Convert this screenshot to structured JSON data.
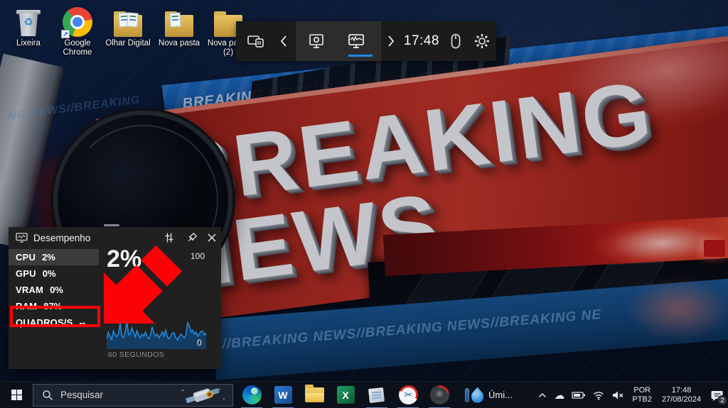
{
  "desktop": {
    "icons": [
      {
        "label": "Lixeira"
      },
      {
        "label": "Google Chrome"
      },
      {
        "label": "Olhar Digital"
      },
      {
        "label": "Nova pasta"
      },
      {
        "label": "Nova pasta (2)"
      }
    ]
  },
  "wallpaper": {
    "headline_line1": "BREAKING",
    "headline_line2": "NEWS",
    "ticker_top": "BREAKING NEWS//BREAKING NEWS//BREAKING NEWS",
    "ticker_left_faint": "NG NEWS//BREAKING",
    "ticker_bottom": "//BREAKING NEWS//BREAKING NEWS//BREAKING NE"
  },
  "gamebar": {
    "time": "17:48"
  },
  "performance_widget": {
    "title": "Desempenho",
    "rows": [
      {
        "label": "CPU",
        "value": "2%",
        "selected": true
      },
      {
        "label": "GPU",
        "value": "0%",
        "selected": false
      },
      {
        "label": "VRAM",
        "value": "0%",
        "selected": false
      },
      {
        "label": "RAM",
        "value": "87%",
        "selected": false
      },
      {
        "label": "QUADROS/S",
        "value": "--",
        "selected": false
      }
    ],
    "graph": {
      "big_value": "2%",
      "y_max": "100",
      "y_min": "0",
      "x_label": "60 SEGUNDOS",
      "line_color": "#1f8fe8",
      "points": [
        30,
        55,
        40,
        28,
        60,
        45,
        38,
        50,
        88,
        42,
        35,
        55,
        95,
        45,
        48,
        70,
        52,
        38,
        60,
        44,
        34,
        48,
        40,
        55,
        38,
        30,
        44,
        75,
        52,
        40,
        48,
        34,
        44,
        56,
        40,
        62,
        38,
        30,
        40,
        52,
        52,
        34,
        26,
        38,
        48,
        40,
        34,
        44,
        90,
        78,
        56,
        62,
        48,
        55,
        40,
        48,
        58,
        58,
        44,
        52
      ]
    }
  },
  "annotations": {
    "arrow_color": "#fb0207"
  },
  "taskbar": {
    "search": {
      "placeholder": "Pesquisar"
    },
    "apps": [
      {
        "name": "edge",
        "running": true
      },
      {
        "name": "word",
        "label": "W",
        "running": true
      },
      {
        "name": "file-explorer",
        "running": false
      },
      {
        "name": "excel",
        "label": "X",
        "running": false
      },
      {
        "name": "notes",
        "running": true
      },
      {
        "name": "video-editor",
        "running": true
      },
      {
        "name": "capture",
        "running": true
      }
    ],
    "weather": {
      "label": "Úmi..."
    },
    "tray": {
      "language_primary": "POR",
      "language_secondary": "PTB2",
      "time": "17:48",
      "date": "27/08/2024",
      "notification_count": "2"
    }
  }
}
